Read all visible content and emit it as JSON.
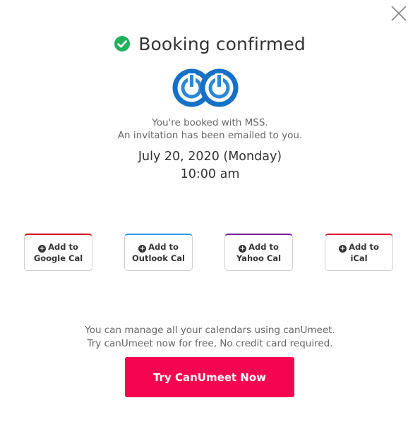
{
  "modal": {
    "title": "Booking confirmed",
    "booked_with": "You're booked with MSS.",
    "invitation_note": "An invitation has been emailed to you.",
    "date": "July 20, 2020 (Monday)",
    "time": "10:00 am"
  },
  "calendar_buttons": [
    {
      "line1": "Add to",
      "line2": "Google Cal",
      "accent": "#d0021b"
    },
    {
      "line1": "Add to",
      "line2": "Outlook Cal",
      "accent": "#2b9de2"
    },
    {
      "line1": "Add to",
      "line2": "Yahoo Cal",
      "accent": "#7b1fa2"
    },
    {
      "line1": "Add to",
      "line2": "iCal",
      "accent": "#e0193a"
    }
  ],
  "promo": {
    "line1": "You can manage all your calendars using canUmeet.",
    "line2": "Try canUmeet now for free, No credit card required.",
    "cta_label": "Try CanUmeet Now"
  },
  "colors": {
    "check": "#20b25d",
    "cta": "#f5054f",
    "logo_blue": "#1670c6"
  },
  "icons": {
    "close": "close-icon",
    "check": "check-circle-icon",
    "plus": "plus-circle-icon"
  }
}
